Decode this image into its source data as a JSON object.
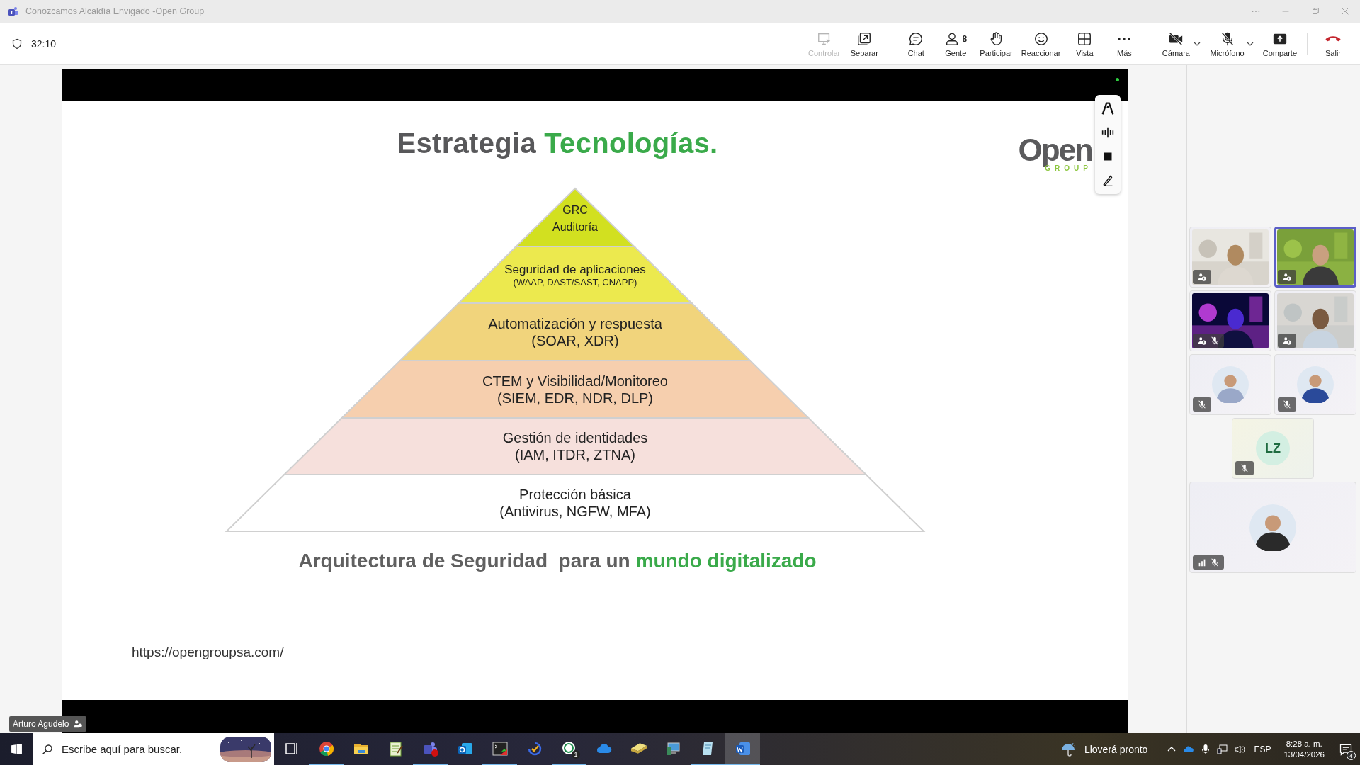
{
  "window": {
    "title": "Conozcamos Alcaldía Envigado -Open Group"
  },
  "meeting": {
    "timer": "32:10"
  },
  "toolbar": {
    "groups": [
      [
        {
          "kind": "control",
          "label": "Controlar",
          "disabled": true,
          "dropdown": false
        },
        {
          "kind": "popout",
          "label": "Separar",
          "disabled": false,
          "dropdown": false
        }
      ],
      [
        {
          "kind": "chat",
          "label": "Chat",
          "disabled": false,
          "dropdown": false
        },
        {
          "kind": "people",
          "label": "Gente",
          "badge": "8",
          "disabled": false,
          "dropdown": false
        },
        {
          "kind": "hand",
          "label": "Participar",
          "disabled": false,
          "dropdown": false
        },
        {
          "kind": "react",
          "label": "Reaccionar",
          "disabled": false,
          "dropdown": false
        },
        {
          "kind": "view",
          "label": "Vista",
          "disabled": false,
          "dropdown": false
        },
        {
          "kind": "more",
          "label": "Más",
          "disabled": false,
          "dropdown": false
        }
      ],
      [
        {
          "kind": "camera",
          "label": "Cámara",
          "disabled": false,
          "dropdown": true
        },
        {
          "kind": "mic",
          "label": "Micrófono",
          "disabled": false,
          "dropdown": true
        },
        {
          "kind": "share",
          "label": "Comparte",
          "disabled": false,
          "dropdown": false
        }
      ],
      [
        {
          "kind": "leave",
          "label": "Salir",
          "disabled": false,
          "dropdown": false
        }
      ]
    ]
  },
  "slide": {
    "title": [
      {
        "text": "Estrategia ",
        "accent": false
      },
      {
        "text": "Tecnologías.",
        "accent": true
      }
    ],
    "logo": {
      "name": "Open",
      "tagline": "GROUP"
    },
    "layers": [
      {
        "color": "#d2e020",
        "lines": [
          {
            "text": "GRC",
            "kind": "main"
          },
          {
            "text": "Auditoría",
            "kind": "main"
          }
        ]
      },
      {
        "color": "#ece94e",
        "lines": [
          {
            "text": "Seguridad de aplicaciones",
            "kind": "main"
          },
          {
            "text": "(WAAP, DAST/SAST, CNAPP)",
            "kind": "note"
          }
        ]
      },
      {
        "color": "#f1d47c",
        "lines": [
          {
            "text": "Automatización y respuesta",
            "kind": "main"
          },
          {
            "text": "(SOAR, XDR)",
            "kind": "main"
          }
        ]
      },
      {
        "color": "#f6cfae",
        "lines": [
          {
            "text": "CTEM y Visibilidad/Monitoreo",
            "kind": "main"
          },
          {
            "text": "(SIEM, EDR, NDR, DLP)",
            "kind": "main"
          }
        ]
      },
      {
        "color": "#f6e0dc",
        "lines": [
          {
            "text": "Gestión de identidades",
            "kind": "main"
          },
          {
            "text": "(IAM, ITDR, ZTNA)",
            "kind": "main"
          }
        ]
      },
      {
        "color": "#ffffff",
        "lines": [
          {
            "text": "Protección básica",
            "kind": "main"
          },
          {
            "text": "(Antivirus, NGFW, MFA)",
            "kind": "main"
          }
        ]
      }
    ],
    "subtitle": [
      {
        "text": "Arquitectura de Seguridad  para un ",
        "accent": false
      },
      {
        "text": "mundo digitalizado",
        "accent": true
      }
    ],
    "url": "https://opengroupsa.com/"
  },
  "presenter": {
    "name": "Arturo Agudelo"
  },
  "participants": [
    {
      "kind": "video",
      "speaking": false,
      "warning": true,
      "muted": false,
      "signal": false
    },
    {
      "kind": "video",
      "speaking": true,
      "warning": true,
      "muted": false,
      "signal": false
    },
    {
      "kind": "video",
      "speaking": false,
      "warning": true,
      "muted": true,
      "signal": false
    },
    {
      "kind": "video",
      "speaking": false,
      "warning": true,
      "muted": false,
      "signal": false
    },
    {
      "kind": "avatar",
      "speaking": false,
      "warning": false,
      "muted": true,
      "signal": false
    },
    {
      "kind": "avatar",
      "speaking": false,
      "warning": false,
      "muted": true,
      "signal": false
    },
    {
      "kind": "initials",
      "initials": "LZ",
      "speaking": false,
      "warning": false,
      "muted": true,
      "signal": false
    },
    {
      "kind": "avatar",
      "speaking": false,
      "warning": false,
      "muted": true,
      "signal": true
    }
  ],
  "taskbar": {
    "search": {
      "placeholder": "Escribe aquí para buscar."
    },
    "apps": [
      {
        "kind": "taskview",
        "running": false,
        "active": false
      },
      {
        "kind": "chrome",
        "running": true,
        "active": false
      },
      {
        "kind": "folder",
        "running": false,
        "active": false
      },
      {
        "kind": "notes",
        "running": false,
        "active": false
      },
      {
        "kind": "teams",
        "running": true,
        "active": false
      },
      {
        "kind": "mail",
        "running": false,
        "active": false
      },
      {
        "kind": "terminal",
        "running": true,
        "active": false
      },
      {
        "kind": "todo",
        "running": false,
        "active": false
      },
      {
        "kind": "chat",
        "running": true,
        "active": false,
        "badge": "1"
      },
      {
        "kind": "cloud",
        "running": false,
        "active": false
      },
      {
        "kind": "stack",
        "running": false,
        "active": false
      },
      {
        "kind": "computer",
        "running": false,
        "active": false
      },
      {
        "kind": "notepad",
        "running": true,
        "active": false
      },
      {
        "kind": "word",
        "running": true,
        "active": true
      }
    ],
    "weather": "Lloverá pronto",
    "language": "ESP",
    "time": "8:28 a. m.",
    "date": "13/04/2026",
    "notifications": "4"
  }
}
